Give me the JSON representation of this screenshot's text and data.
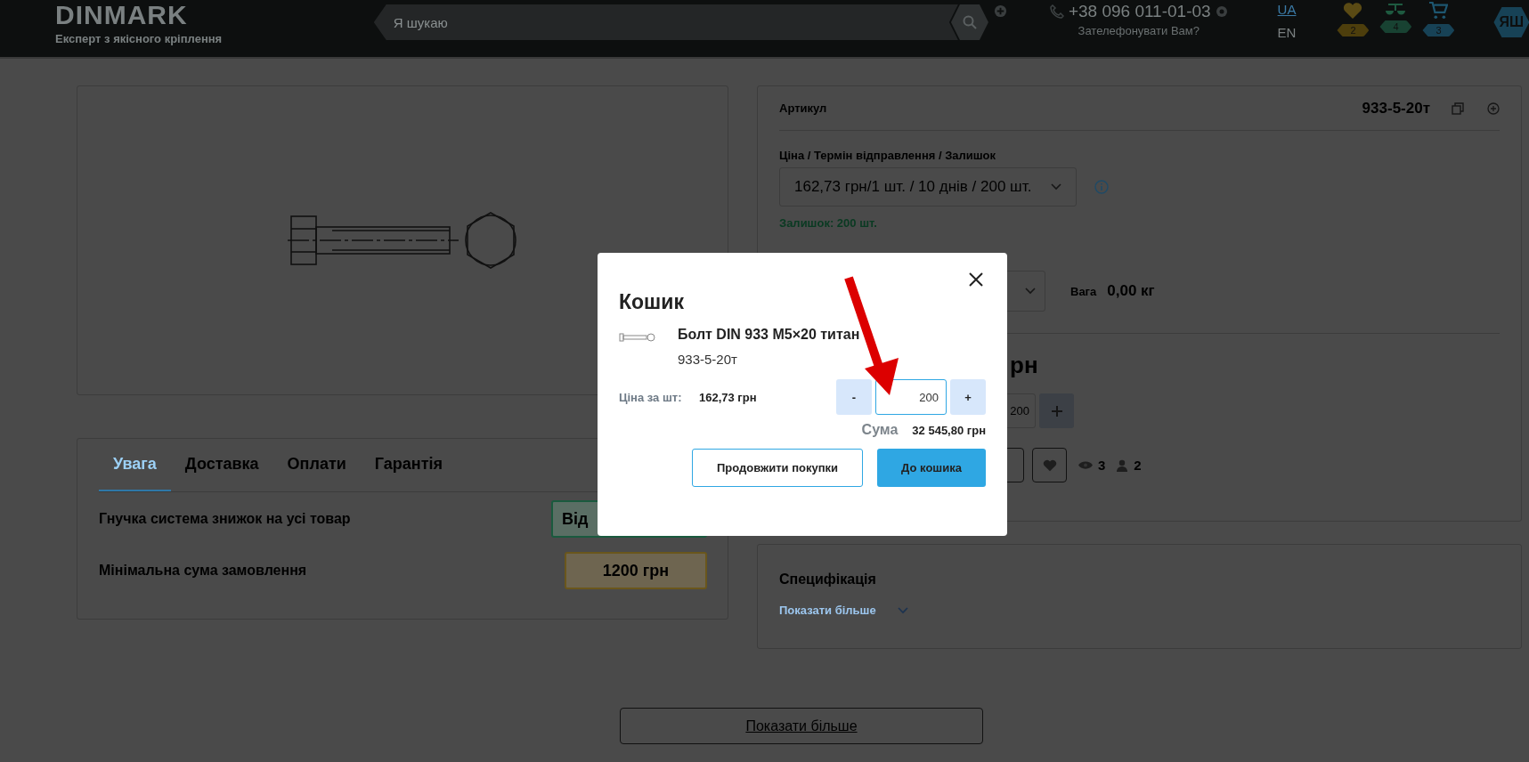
{
  "header": {
    "logo": "DINMARK",
    "tagline": "Експерт з якісного кріплення",
    "search": {
      "placeholder": "Я шукаю"
    },
    "phone": {
      "number": "+38 096 011-01-03",
      "callback": "Зателефонувати Вам?"
    },
    "languages": [
      {
        "label": "UA",
        "selected": true
      },
      {
        "label": "EN",
        "selected": false
      }
    ],
    "counters": [
      {
        "kind": "favorites",
        "count": "2",
        "color": "#4d3e0c"
      },
      {
        "kind": "compare",
        "count": "4",
        "color": "#184232"
      },
      {
        "kind": "cart",
        "count": "3",
        "color": "#174256"
      }
    ],
    "account": "ЯШ"
  },
  "info": {
    "tabs": [
      {
        "label": "Увага",
        "selected": true
      },
      {
        "label": "Доставка",
        "selected": false
      },
      {
        "label": "Оплати",
        "selected": false
      },
      {
        "label": "Гарантія",
        "selected": false
      }
    ],
    "rows": [
      {
        "label": "Гнучка система знижок на усі товар",
        "value": "Від",
        "kind": "discount"
      },
      {
        "label": "Мінімальна сума замовлення",
        "value": "1200 грн",
        "kind": "minimum"
      }
    ]
  },
  "details": {
    "article": {
      "label": "Артикул",
      "value": "933-5-20т"
    },
    "offer": {
      "label": "Ціна / Термін відправлення / Залишок",
      "value": "162,73 грн/1 шт. / 10 днів / 200 шт."
    },
    "stock": "Залишок: 200 шт.",
    "weight": {
      "label": "Вага",
      "value": "0,00 кг"
    },
    "price": "рн",
    "quantity": "200",
    "views": "3",
    "watchers": "2"
  },
  "specification": {
    "title": "Специфікація",
    "link": "Показати більше"
  },
  "show_more": "Показати більше",
  "cart_modal": {
    "title": "Кошик",
    "product": {
      "name": "Болт DIN 933 M5×20 титан",
      "sku": "933-5-20т"
    },
    "unit_price": {
      "label": "Ціна за шт:",
      "value": "162,73 грн"
    },
    "quantity": "200",
    "decrease": "-",
    "increase": "+",
    "total": {
      "label": "Сума",
      "value": "32 545,80 грн"
    },
    "buttons": [
      {
        "label": "Продовжити покупки",
        "kind": "secondary"
      },
      {
        "label": "До кошика",
        "kind": "primary"
      }
    ]
  }
}
